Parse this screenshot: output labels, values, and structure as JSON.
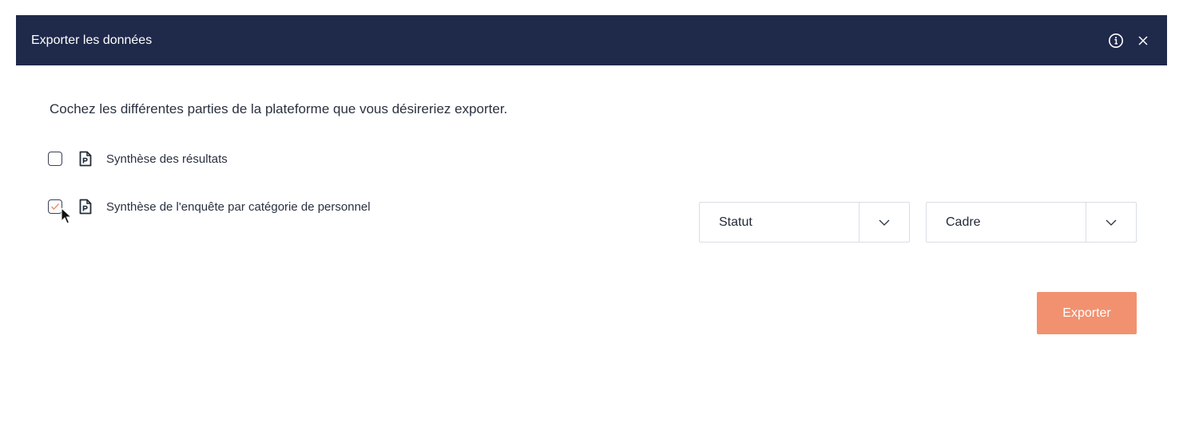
{
  "modal": {
    "title": "Exporter les données",
    "info_icon": "info-icon",
    "close_icon": "close-icon"
  },
  "intro_text": "Cochez les différentes parties de la plateforme que vous désireriez exporter.",
  "items": [
    {
      "label": "Synthèse des résultats",
      "checked": false,
      "icon": "pdf-file-icon"
    },
    {
      "label": "Synthèse de l'enquête par catégorie de personnel",
      "checked": true,
      "icon": "pdf-file-icon"
    }
  ],
  "selects": {
    "category": {
      "value": "Statut"
    },
    "subcategory": {
      "value": "Cadre"
    }
  },
  "export_button": {
    "label": "Exporter"
  },
  "colors": {
    "header_bg": "#1f294a",
    "accent": "#f2916f"
  }
}
